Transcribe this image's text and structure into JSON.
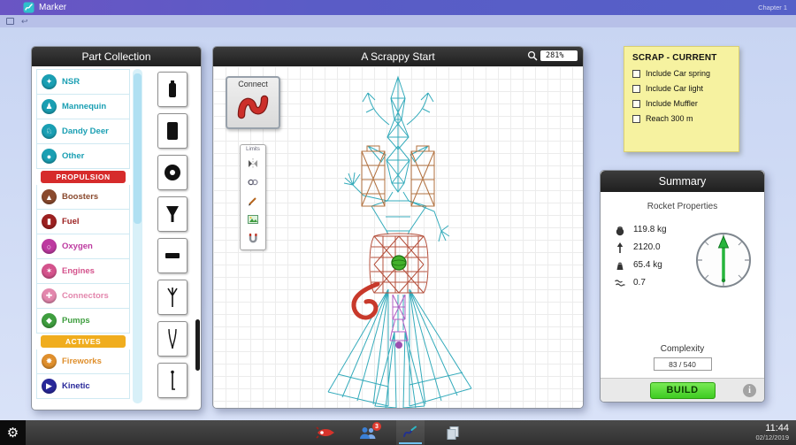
{
  "titlebar": {
    "app_title": "Marker",
    "chapter_label": "Chapter 1"
  },
  "part_collection": {
    "title": "Part Collection",
    "categories": [
      {
        "label": "NSR",
        "color": "#1a9fb3",
        "glyph": "✦"
      },
      {
        "label": "Mannequin",
        "color": "#1a9fb3",
        "glyph": "♟"
      },
      {
        "label": "Dandy Deer",
        "color": "#1a9fb3",
        "glyph": "♘"
      },
      {
        "label": "Other",
        "color": "#1a9fb3",
        "glyph": "●"
      },
      {
        "label": "PROPULSION",
        "type": "banner",
        "color": "#d62b2b"
      },
      {
        "label": "Boosters",
        "color": "#8a4a2e",
        "glyph": "▲"
      },
      {
        "label": "Fuel",
        "color": "#9c2121",
        "glyph": "▮"
      },
      {
        "label": "Oxygen",
        "color": "#bd3aa0",
        "glyph": "○"
      },
      {
        "label": "Engines",
        "color": "#d4538c",
        "glyph": "✶"
      },
      {
        "label": "Connectors",
        "color": "#e387ad",
        "glyph": "✚"
      },
      {
        "label": "Pumps",
        "color": "#3f9e3f",
        "glyph": "◆"
      },
      {
        "label": "ACTIVES",
        "type": "banner",
        "color": "#f0ad1e"
      },
      {
        "label": "Fireworks",
        "color": "#df8f2d",
        "glyph": "✸"
      },
      {
        "label": "Kinetic",
        "color": "#28289a",
        "glyph": "▶"
      }
    ],
    "thumbnails": [
      {
        "name": "battery-part"
      },
      {
        "name": "block-part"
      },
      {
        "name": "wheel-part"
      },
      {
        "name": "funnel-part"
      },
      {
        "name": "plate-part"
      },
      {
        "name": "whisk-part"
      },
      {
        "name": "clamp-part"
      },
      {
        "name": "rod-part"
      }
    ]
  },
  "workshop": {
    "title": "A Scrappy Start",
    "zoom": "281%",
    "selected_part_label": "Connect",
    "tools_label": "Limits"
  },
  "scrap_note": {
    "title": "SCRAP  - CURRENT",
    "items": [
      "Include Car spring",
      "Include Car light",
      "Include Muffler",
      "Reach 300 m"
    ]
  },
  "summary": {
    "title": "Summary",
    "subtitle": "Rocket Properties",
    "stats": [
      {
        "icon": "mass-icon",
        "value": "119.8 kg"
      },
      {
        "icon": "thrust-icon",
        "value": "2120.0"
      },
      {
        "icon": "dry-mass-icon",
        "value": "65.4 kg"
      },
      {
        "icon": "drag-icon",
        "value": "0.7"
      }
    ],
    "complexity_label": "Complexity",
    "complexity_value": "83 / 540",
    "build_label": "BUILD",
    "info_label": "i"
  },
  "taskbar": {
    "start_icon": "⚙",
    "badge_count": "3",
    "clock": "11:44",
    "date": "02/12/2019"
  },
  "colors": {
    "build_button_border": "#2e9e12",
    "active_app_underline": "#6fc2f0",
    "badge": "#e03a2f"
  }
}
